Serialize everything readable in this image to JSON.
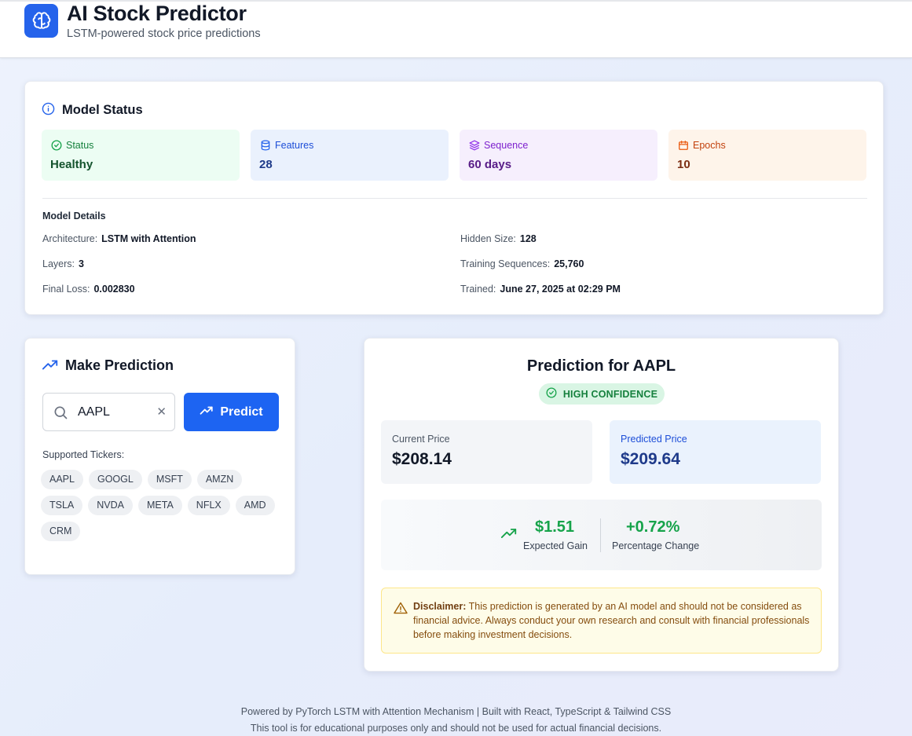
{
  "header": {
    "title": "AI Stock Predictor",
    "subtitle": "LSTM-powered stock price predictions",
    "logo_icon": "brain-icon",
    "accent": "#2563eb"
  },
  "model_status": {
    "title": "Model Status",
    "tiles": [
      {
        "label": "Status",
        "value": "Healthy",
        "icon": "check-circle-icon",
        "bg": "#ecfdf3",
        "label_color": "#15803d",
        "value_color": "#14532d"
      },
      {
        "label": "Features",
        "value": "28",
        "icon": "database-icon",
        "bg": "#eaf1fd",
        "label_color": "#1d4ed8",
        "value_color": "#1e3a8a"
      },
      {
        "label": "Sequence",
        "value": "60 days",
        "icon": "layers-icon",
        "bg": "#f6effd",
        "label_color": "#7e22ce",
        "value_color": "#581c87"
      },
      {
        "label": "Epochs",
        "value": "10",
        "icon": "calendar-icon",
        "bg": "#fef4ea",
        "label_color": "#c2410c",
        "value_color": "#7c2d12"
      }
    ],
    "details_title": "Model Details",
    "details": [
      {
        "label": "Architecture:",
        "value": "LSTM with Attention"
      },
      {
        "label": "Hidden Size:",
        "value": "128"
      },
      {
        "label": "Layers:",
        "value": "3"
      },
      {
        "label": "Training Sequences:",
        "value": "25,760"
      },
      {
        "label": "Final Loss:",
        "value": "0.002830"
      },
      {
        "label": "Trained:",
        "value": "June 27, 2025 at 02:29 PM"
      }
    ]
  },
  "make_prediction": {
    "title": "Make Prediction",
    "ticker_value": "AAPL",
    "predict_label": "Predict",
    "supported_label": "Supported Tickers:",
    "tickers": [
      "AAPL",
      "GOOGL",
      "MSFT",
      "AMZN",
      "TSLA",
      "NVDA",
      "META",
      "NFLX",
      "AMD",
      "CRM"
    ]
  },
  "result": {
    "title": "Prediction for AAPL",
    "confidence": "HIGH CONFIDENCE",
    "current_label": "Current Price",
    "current_value": "$208.14",
    "predicted_label": "Predicted Price",
    "predicted_value": "$209.64",
    "gain_value": "$1.51",
    "gain_label": "Expected Gain",
    "pct_value": "+0.72%",
    "pct_label": "Percentage Change",
    "disclaimer_bold": "Disclaimer:",
    "disclaimer_text": " This prediction is generated by an AI model and should not be considered as financial advice. Always conduct your own research and consult with financial professionals before making investment decisions."
  },
  "footer": {
    "line1": "Powered by PyTorch LSTM with Attention Mechanism | Built with React, TypeScript & Tailwind CSS",
    "line2": "This tool is for educational purposes only and should not be used for actual financial decisions."
  }
}
